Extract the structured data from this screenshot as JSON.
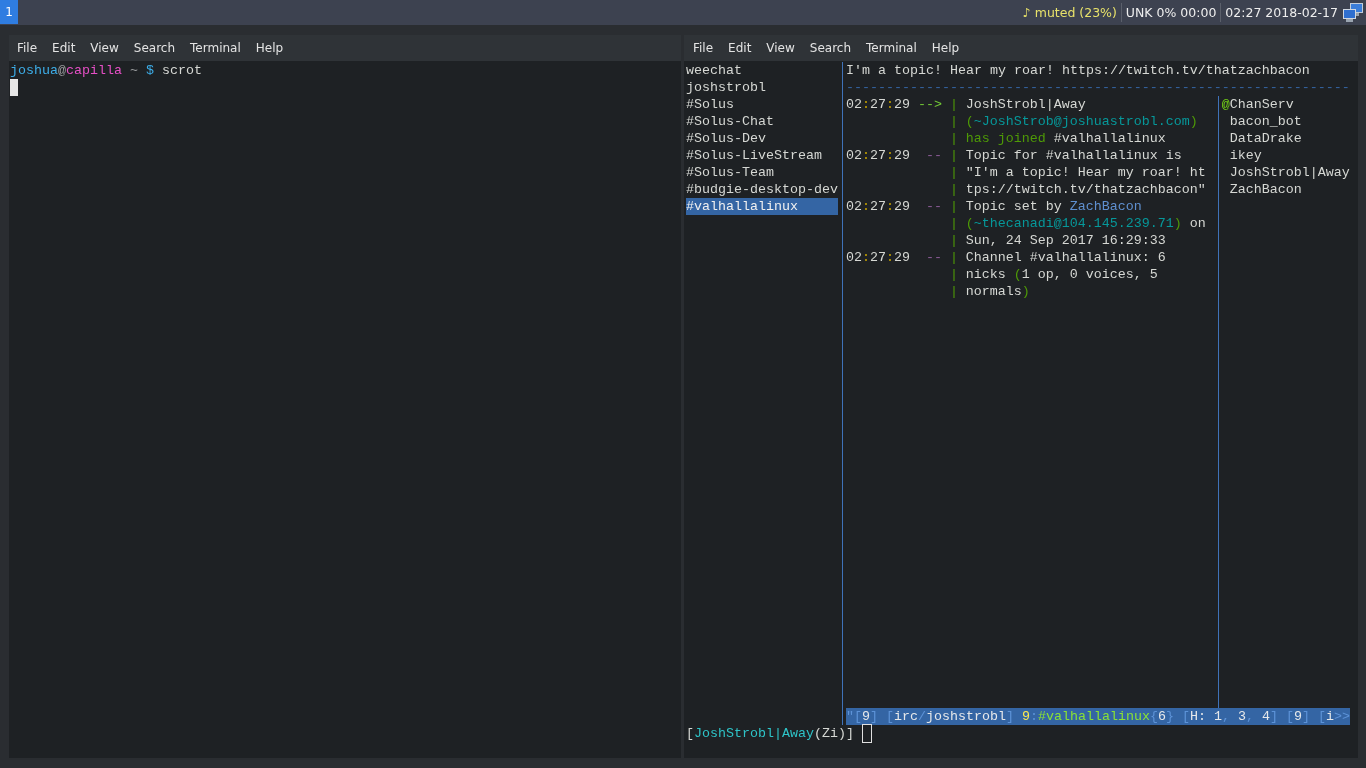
{
  "top_bar": {
    "workspaces": [
      {
        "label": "1",
        "selected": true
      }
    ],
    "status": [
      {
        "text": "♪ muted (23%)",
        "kind": "volume"
      },
      {
        "text": "UNK 0% 00:00",
        "kind": "battery"
      },
      {
        "text": "02:27 2018-02-17",
        "kind": "clock"
      }
    ]
  },
  "windows": [
    {
      "kind": "shell",
      "menu": [
        "File",
        "Edit",
        "View",
        "Search",
        "Terminal",
        "Help"
      ],
      "lines": [
        [
          {
            "text": "joshua",
            "kind": "shell_user"
          },
          {
            "text": "@",
            "kind": "shell_at"
          },
          {
            "text": "capilla",
            "kind": "shell_host"
          },
          {
            "text": " ~ ",
            "kind": "shell_dir"
          },
          {
            "text": "$",
            "kind": "shell_prompt"
          },
          {
            "text": " scrot",
            "kind": "plain"
          }
        ]
      ]
    },
    {
      "kind": "weechat",
      "menu": [
        "File",
        "Edit",
        "View",
        "Search",
        "Terminal",
        "Help"
      ],
      "buffers": [
        {
          "name": "weechat",
          "selected": false
        },
        {
          "name": "joshstrobl",
          "selected": false
        },
        {
          "name": "#Solus",
          "selected": false
        },
        {
          "name": "#Solus-Chat",
          "selected": false
        },
        {
          "name": "#Solus-Dev",
          "selected": false
        },
        {
          "name": "#Solus-LiveStream",
          "selected": false
        },
        {
          "name": "#Solus-Team",
          "selected": false
        },
        {
          "name": "#budgie-desktop-dev",
          "selected": false
        },
        {
          "name": "#valhallalinux",
          "selected": true
        }
      ],
      "topic": "I'm a topic! Hear my roar! https://twitch.tv/thatzachbacon",
      "read_marker": "---------------------------------------------------------------",
      "messages": [
        {
          "time": [
            {
              "text": "02",
              "kind": "plain"
            },
            {
              "text": ":",
              "kind": "time_sep"
            },
            {
              "text": "27",
              "kind": "plain"
            },
            {
              "text": ":",
              "kind": "time_sep"
            },
            {
              "text": "29",
              "kind": "plain"
            }
          ],
          "prefix": [
            {
              "text": "-->",
              "kind": "join"
            }
          ],
          "lines": [
            {
              "bar": "|",
              "segments": [
                {
                  "text": "JoshStrobl|Away",
                  "kind": "plain"
                }
              ]
            },
            {
              "bar": "|",
              "segments": [
                {
                  "text": "(",
                  "kind": "delim"
                },
                {
                  "text": "~JoshStrob@joshuastrobl.com",
                  "kind": "host"
                },
                {
                  "text": ")",
                  "kind": "delim"
                }
              ]
            },
            {
              "bar": "|",
              "segments": [
                {
                  "text": "has joined",
                  "kind": "action"
                },
                {
                  "text": " #valhallalinux",
                  "kind": "plain"
                }
              ]
            }
          ]
        },
        {
          "time": [
            {
              "text": "02",
              "kind": "plain"
            },
            {
              "text": ":",
              "kind": "time_sep"
            },
            {
              "text": "27",
              "kind": "plain"
            },
            {
              "text": ":",
              "kind": "time_sep"
            },
            {
              "text": "29",
              "kind": "plain"
            }
          ],
          "prefix": [
            {
              "text": "--",
              "kind": "network"
            }
          ],
          "lines": [
            {
              "bar": "|",
              "segments": [
                {
                  "text": "Topic for #valhallalinux is",
                  "kind": "plain"
                }
              ]
            },
            {
              "bar": "|",
              "segments": [
                {
                  "text": "\"I'm a topic! Hear my roar! ht",
                  "kind": "plain"
                }
              ]
            },
            {
              "bar": "|",
              "segments": [
                {
                  "text": "tps://twitch.tv/thatzachbacon\"",
                  "kind": "plain"
                }
              ]
            }
          ]
        },
        {
          "time": [
            {
              "text": "02",
              "kind": "plain"
            },
            {
              "text": ":",
              "kind": "time_sep"
            },
            {
              "text": "27",
              "kind": "plain"
            },
            {
              "text": ":",
              "kind": "time_sep"
            },
            {
              "text": "29",
              "kind": "plain"
            }
          ],
          "prefix": [
            {
              "text": "--",
              "kind": "network"
            }
          ],
          "lines": [
            {
              "bar": "|",
              "segments": [
                {
                  "text": "Topic set by ",
                  "kind": "plain"
                },
                {
                  "text": "ZachBacon",
                  "kind": "nick"
                }
              ]
            },
            {
              "bar": "|",
              "segments": [
                {
                  "text": "(",
                  "kind": "delim"
                },
                {
                  "text": "~thecanadi@104.145.239.71",
                  "kind": "host"
                },
                {
                  "text": ")",
                  "kind": "delim"
                },
                {
                  "text": " on",
                  "kind": "plain"
                }
              ]
            },
            {
              "bar": "|",
              "segments": [
                {
                  "text": "Sun, 24 Sep 2017 16:29:33",
                  "kind": "plain"
                }
              ]
            }
          ]
        },
        {
          "time": [
            {
              "text": "02",
              "kind": "plain"
            },
            {
              "text": ":",
              "kind": "time_sep"
            },
            {
              "text": "27",
              "kind": "plain"
            },
            {
              "text": ":",
              "kind": "time_sep"
            },
            {
              "text": "29",
              "kind": "plain"
            }
          ],
          "prefix": [
            {
              "text": "--",
              "kind": "network"
            }
          ],
          "lines": [
            {
              "bar": "|",
              "segments": [
                {
                  "text": "Channel #valhallalinux: 6",
                  "kind": "plain"
                }
              ]
            },
            {
              "bar": "|",
              "segments": [
                {
                  "text": "nicks ",
                  "kind": "plain"
                },
                {
                  "text": "(",
                  "kind": "delim"
                },
                {
                  "text": "1 op, 0 voices, 5",
                  "kind": "plain"
                }
              ]
            },
            {
              "bar": "|",
              "segments": [
                {
                  "text": "normals",
                  "kind": "plain"
                },
                {
                  "text": ")",
                  "kind": "delim"
                }
              ]
            }
          ]
        }
      ],
      "nicks": [
        {
          "prefix": "@",
          "name": "ChanServ"
        },
        {
          "name": "bacon_bot"
        },
        {
          "name": "DataDrake"
        },
        {
          "name": "ikey"
        },
        {
          "name": "JoshStrobl|Away"
        },
        {
          "name": "ZachBacon"
        }
      ],
      "status_bar": [
        {
          "text": "\"[",
          "kind": "status_delim"
        },
        {
          "text": "9",
          "kind": "status_text"
        },
        {
          "text": "] [",
          "kind": "status_delim"
        },
        {
          "text": "irc",
          "kind": "status_text"
        },
        {
          "text": "/",
          "kind": "status_delim"
        },
        {
          "text": "joshstrobl",
          "kind": "status_text"
        },
        {
          "text": "] ",
          "kind": "status_delim"
        },
        {
          "text": "9",
          "kind": "status_number"
        },
        {
          "text": ":",
          "kind": "status_delim"
        },
        {
          "text": "#valhallalinux",
          "kind": "status_channel"
        },
        {
          "text": "{",
          "kind": "status_delim"
        },
        {
          "text": "6",
          "kind": "status_text"
        },
        {
          "text": "} [",
          "kind": "status_delim"
        },
        {
          "text": "H: 1",
          "kind": "status_text"
        },
        {
          "text": ", ",
          "kind": "status_delim"
        },
        {
          "text": "3",
          "kind": "status_text"
        },
        {
          "text": ", ",
          "kind": "status_delim"
        },
        {
          "text": "4",
          "kind": "status_text"
        },
        {
          "text": "] [",
          "kind": "status_delim"
        },
        {
          "text": "9",
          "kind": "status_text"
        },
        {
          "text": "] [",
          "kind": "status_delim"
        },
        {
          "text": "i",
          "kind": "status_text"
        },
        {
          "text": ">>",
          "kind": "status_delim"
        }
      ],
      "input": [
        {
          "text": "[",
          "kind": "plain"
        },
        {
          "text": "JoshStrobl|Away",
          "kind": "own_nick"
        },
        {
          "text": "(Zi)]",
          "kind": "plain"
        }
      ]
    }
  ]
}
